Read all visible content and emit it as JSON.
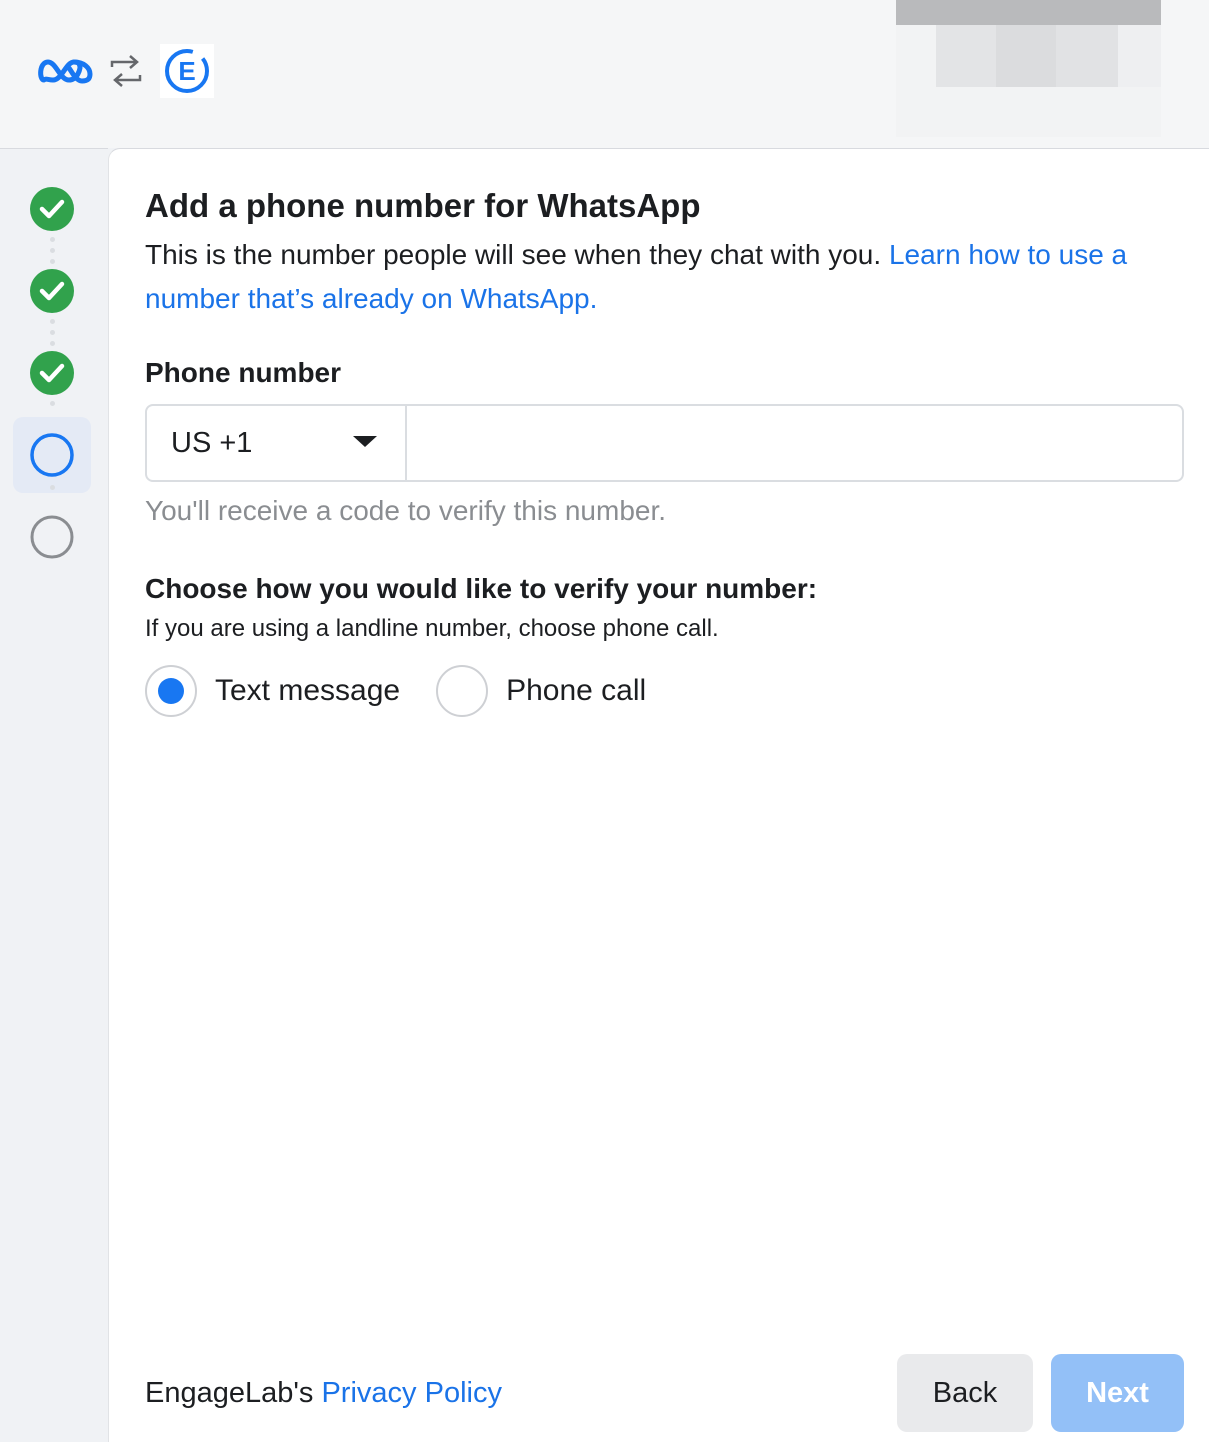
{
  "header": {
    "logos": [
      "meta-logo-icon",
      "sync-arrows-icon",
      "engagelab-logo-icon"
    ],
    "brand_color": "#1877f2"
  },
  "steps": [
    {
      "state": "complete",
      "icon": "check-circle-icon"
    },
    {
      "state": "complete",
      "icon": "check-circle-icon"
    },
    {
      "state": "complete",
      "icon": "check-circle-icon"
    },
    {
      "state": "active",
      "icon": "circle-outline-icon"
    },
    {
      "state": "pending",
      "icon": "circle-outline-icon"
    }
  ],
  "form": {
    "title": "Add a phone number for WhatsApp",
    "description": "This is the number people will see when they chat with you. ",
    "learn_link": "Learn how to use a number that’s already on WhatsApp.",
    "phone_label": "Phone number",
    "country_code": "US +1",
    "phone_value": "",
    "phone_hint": "You'll receive a code to verify this number.",
    "verify_heading": "Choose how you would like to verify your number:",
    "verify_sub": "If you are using a landline number, choose phone call.",
    "options": [
      {
        "label": "Text message",
        "selected": true
      },
      {
        "label": "Phone call",
        "selected": false
      }
    ]
  },
  "footer": {
    "policy_prefix": "EngageLab's ",
    "policy_link": "Privacy Policy",
    "back_label": "Back",
    "next_label": "Next"
  },
  "colors": {
    "success": "#31a24c",
    "link": "#1a73e8",
    "next_disabled": "#93c0f7"
  }
}
